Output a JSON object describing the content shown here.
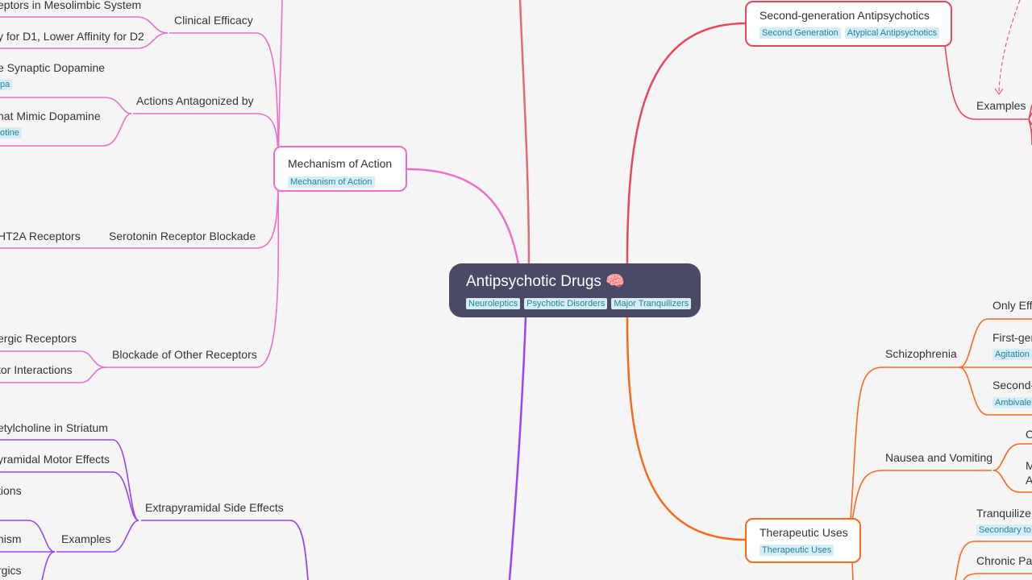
{
  "colors": {
    "pink": "#ec6fcf",
    "red": "#e8475c",
    "orange": "#fb6a1c",
    "purple": "#9b45f2",
    "salmon": "#e06c75",
    "root": "#4a4a66",
    "tag_bg": "#d3eef7"
  },
  "root": {
    "label": "Antipsychotic Drugs",
    "icon": "brain-icon",
    "tags": [
      "Neuroleptics",
      "Psychotic Disorders",
      "Major Tranquilizers"
    ]
  },
  "mechanism": {
    "label": "Mechanism of Action",
    "tags": [
      "Mechanism of Action"
    ],
    "clinical_efficacy": {
      "label": "Clinical Efficacy",
      "children": [
        "eptors in Mesolimbic System",
        "y for D1, Lower Affinity for D2"
      ]
    },
    "actions_antagonized": {
      "label": "Actions Antagonized by",
      "children": [
        {
          "label": "e Synaptic Dopamine",
          "tag": "pa"
        },
        {
          "label": "hat Mimic Dopamine",
          "tag": "otine"
        }
      ]
    },
    "serotonin": {
      "label": "Serotonin Receptor Blockade",
      "children": [
        "HT2A Receptors"
      ]
    },
    "blockade_other": {
      "label": "Blockade of Other Receptors",
      "children": [
        "ergic Receptors",
        "tor Interactions"
      ]
    }
  },
  "extrapyramidal": {
    "label": "Extrapyramidal Side Effects",
    "children": [
      "etylcholine in Striatum",
      "yramidal Motor Effects",
      "tions"
    ],
    "examples": {
      "label": "Examples",
      "children": [
        "nism",
        "rgics"
      ]
    }
  },
  "second_gen": {
    "label": "Second-generation Antipsychotics",
    "tags": [
      "Second Generation",
      "Atypical Antipsychotics"
    ],
    "examples_label": "Examples"
  },
  "therapeutic": {
    "label": "Therapeutic Uses",
    "tags": [
      "Therapeutic Uses"
    ],
    "schizophrenia": {
      "label": "Schizophrenia",
      "children": [
        {
          "label": "Only Effi"
        },
        {
          "label": "First-ger",
          "tag": "Agitation"
        },
        {
          "label": "Second-",
          "tag": "Ambivaler"
        }
      ]
    },
    "nausea": {
      "label": "Nausea and Vomiting",
      "children": [
        "O",
        "M",
        "A"
      ]
    },
    "tranquilizer": {
      "label": "Tranquilizer",
      "tag": "Secondary to C"
    },
    "chronic_pain": {
      "label": "Chronic Pai"
    }
  }
}
